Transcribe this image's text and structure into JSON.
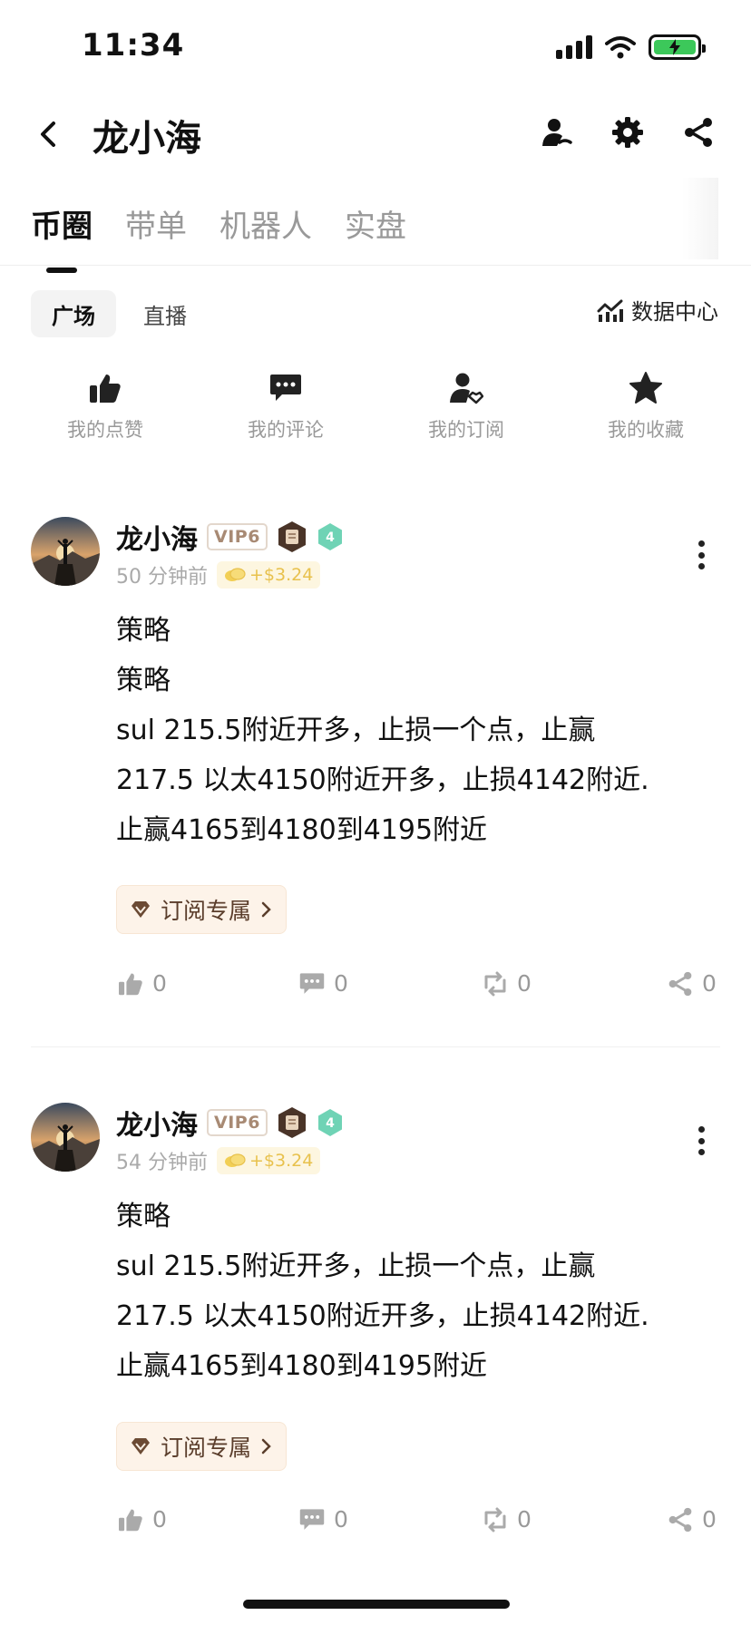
{
  "status_bar": {
    "time": "11:34"
  },
  "header": {
    "title": "龙小海"
  },
  "top_tabs": [
    "币圈",
    "带单",
    "机器人",
    "实盘"
  ],
  "sub_tabs": [
    "广场",
    "直播"
  ],
  "data_center_label": "数据中心",
  "quick_actions": [
    {
      "label": "我的点赞",
      "icon": "thumbs-up-icon"
    },
    {
      "label": "我的评论",
      "icon": "comment-icon"
    },
    {
      "label": "我的订阅",
      "icon": "subscribe-user-icon"
    },
    {
      "label": "我的收藏",
      "icon": "star-icon"
    }
  ],
  "posts": [
    {
      "author": "龙小海",
      "vip": "VIP6",
      "level": "4",
      "time": "50 分钟前",
      "reward": "+$3.24",
      "lines": [
        "策略",
        "策略",
        "sul 215.5附近开多，止损一个点，止赢",
        "217.5 以太4150附近开多，止损4142附近.",
        "止赢4165到4180到4195附近"
      ],
      "subscribe_label": "订阅专属",
      "likes": "0",
      "comments": "0",
      "reposts": "0",
      "shares": "0"
    },
    {
      "author": "龙小海",
      "vip": "VIP6",
      "level": "4",
      "time": "54 分钟前",
      "reward": "+$3.24",
      "lines": [
        "策略",
        "sul 215.5附近开多，止损一个点，止赢",
        "217.5 以太4150附近开多，止损4142附近.",
        "止赢4165到4180到4195附近"
      ],
      "subscribe_label": "订阅专属",
      "likes": "0",
      "comments": "0",
      "reposts": "0",
      "shares": "0"
    }
  ],
  "colors": {
    "accent_text": "#111111",
    "muted": "#999999",
    "vip_border": "#e3d7cc",
    "reward_text": "#e8c14c",
    "level_badge": "#6fd3b5",
    "battery_fill": "#3cc85a"
  }
}
